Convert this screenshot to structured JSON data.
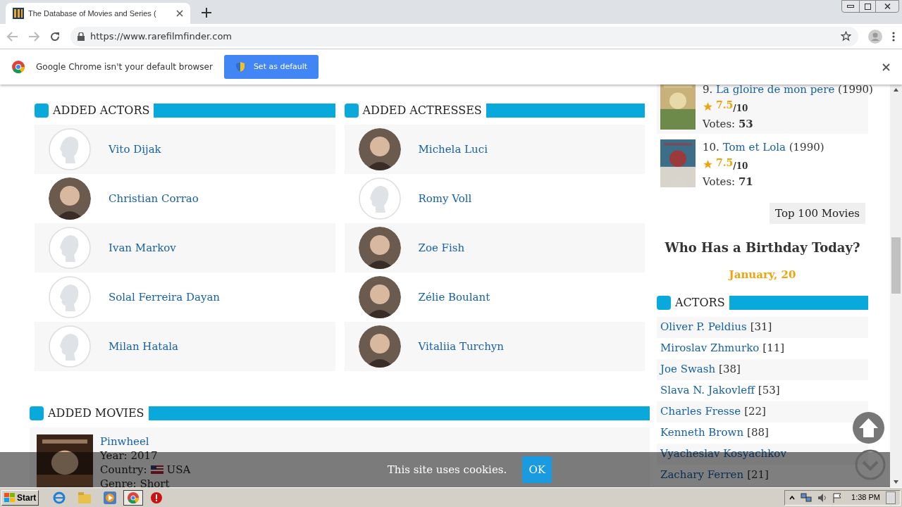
{
  "browser": {
    "tab_title": "The Database of Movies and Series (",
    "url": "https://www.rarefilmfinder.com"
  },
  "infobar": {
    "message": "Google Chrome isn't your default browser",
    "button": "Set as default"
  },
  "actors": {
    "title": "ADDED ACTORS",
    "items": [
      {
        "name": "Vito Dijak",
        "kind": "silhouette"
      },
      {
        "name": "Christian Corrao"
      },
      {
        "name": "Ivan Markov",
        "kind": "silhouette"
      },
      {
        "name": "Solal Ferreira Dayan",
        "kind": "silhouette"
      },
      {
        "name": "Milan Hatala",
        "kind": "silhouette"
      }
    ]
  },
  "actresses": {
    "title": "ADDED ACTRESSES",
    "items": [
      {
        "name": "Michela Luci"
      },
      {
        "name": "Romy Voll",
        "kind": "silhouette"
      },
      {
        "name": "Zoe Fish"
      },
      {
        "name": "Zélie Boulant"
      },
      {
        "name": "Vitaliia Turchyn"
      }
    ]
  },
  "movies": {
    "title": "ADDED MOVIES",
    "items": [
      {
        "title": "Pinwheel",
        "year_label": "Year:",
        "year": "2017",
        "country_label": "Country:",
        "country": "USA",
        "genre_label": "Genre:",
        "genre": "Short"
      }
    ]
  },
  "top_movies": [
    {
      "rank": "9.",
      "title": "La gloire de mon pere",
      "year": "(1990)",
      "rating": "7.5",
      "scale": "/10",
      "votes_label": "Votes:",
      "votes": "53"
    },
    {
      "rank": "10.",
      "title": "Tom et Lola",
      "year": "(1990)",
      "rating": "7.5",
      "scale": "/10",
      "votes_label": "Votes:",
      "votes": "71"
    }
  ],
  "top_button": "Top 100 Movies",
  "birthday": {
    "title": "Who Has a Birthday Today?",
    "date": "January, 20",
    "section": "ACTORS",
    "items": [
      {
        "name": "Oliver P. Peldius",
        "count": "[31]"
      },
      {
        "name": "Miroslav Zhmurko",
        "count": "[11]"
      },
      {
        "name": "Joe Swash",
        "count": "[38]"
      },
      {
        "name": "Slava N. Jakovleff",
        "count": "[53]"
      },
      {
        "name": "Charles Fresse",
        "count": "[22]"
      },
      {
        "name": "Kenneth Brown",
        "count": "[88]"
      },
      {
        "name": "Vyacheslav Kosyachkov"
      },
      {
        "name": "Zachary Ferren",
        "count": "[21]"
      }
    ]
  },
  "cookie": {
    "message": "This site uses cookies.",
    "button": "OK"
  },
  "taskbar": {
    "start": "Start",
    "time": "1:38 PM"
  }
}
